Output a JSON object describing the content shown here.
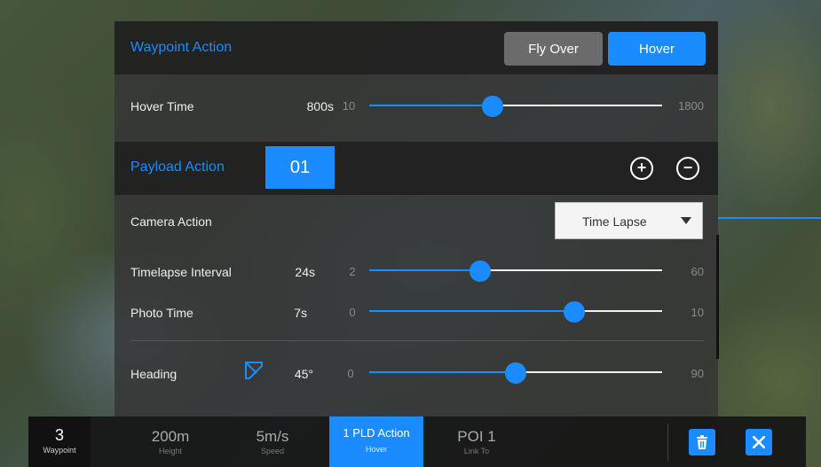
{
  "waypoint_action": {
    "title": "Waypoint Action",
    "options": [
      "Fly Over",
      "Hover"
    ],
    "selected": "Hover"
  },
  "hover_time": {
    "label": "Hover Time",
    "value": "800s",
    "min": "10",
    "max": "1800",
    "level": 0.42
  },
  "payload_action": {
    "title": "Payload Action",
    "index": "01",
    "add_icon": "plus-circle-icon",
    "remove_icon": "minus-circle-icon"
  },
  "camera_action": {
    "label": "Camera Action",
    "value": "Time Lapse"
  },
  "timelapse_interval": {
    "label": "Timelapse Interval",
    "value": "24s",
    "min": "2",
    "max": "60",
    "level": 0.38
  },
  "photo_time": {
    "label": "Photo Time",
    "value": "7s",
    "min": "0",
    "max": "10",
    "level": 0.7
  },
  "heading": {
    "label": "Heading",
    "value": "45°",
    "min": "0",
    "max": "90",
    "level": 0.5,
    "icon": "heading-direction-icon"
  },
  "bottom_bar": {
    "waypoint": {
      "value": "3",
      "label": "Waypoint"
    },
    "height": {
      "value": "200m",
      "label": "Height"
    },
    "speed": {
      "value": "5m/s",
      "label": "Speed"
    },
    "pld_action": {
      "value": "1 PLD Action",
      "label": "Hover"
    },
    "poi": {
      "value": "POI 1",
      "label": "Link To"
    },
    "delete_icon": "trash-icon",
    "close_icon": "close-icon"
  },
  "colors": {
    "accent": "#1a8cff",
    "panel": "#343434",
    "header": "#202020",
    "inactive_button": "#6b6b6b"
  }
}
